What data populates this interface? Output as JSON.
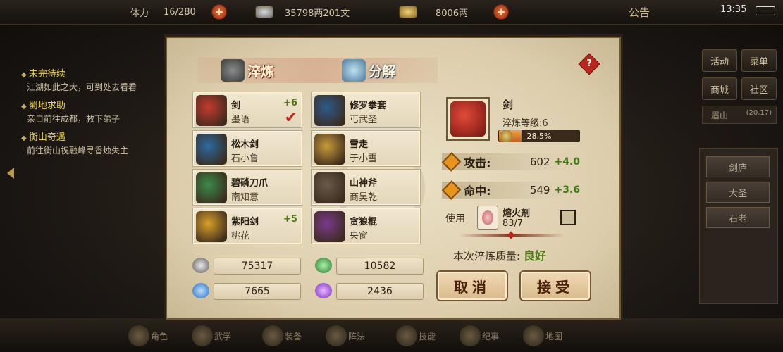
{
  "topbar": {
    "stamina_label": "体力",
    "stamina_value": "16/280",
    "silver_value": "35798两201文",
    "gold_value": "8006两",
    "notice_label": "公告",
    "time": "13:35"
  },
  "quests": [
    {
      "title": "未完待续",
      "desc": "江湖如此之大，可到处去看看"
    },
    {
      "title": "蜀地求助",
      "desc": "亲自前往成都，救下弟子"
    },
    {
      "title": "衡山奇遇",
      "desc": "前往衡山祝融峰寻香烛失主"
    }
  ],
  "right_menu": {
    "buttons": [
      "活动",
      "菜单",
      "商城",
      "社区"
    ],
    "location": "眉山",
    "location_coord": "(20,17)",
    "list": [
      "剑庐",
      "大圣",
      "石老"
    ]
  },
  "dialog": {
    "tab_refine": "淬炼",
    "tab_decompose": "分解",
    "help_icon": "?",
    "items": [
      {
        "name": "剑",
        "owner": "墨语",
        "level": "+6",
        "checked": true,
        "color": "#c43a2e"
      },
      {
        "name": "修罗拳套",
        "owner": "丐武圣",
        "level": "",
        "checked": false,
        "color": "#2e5a8a"
      },
      {
        "name": "松木剑",
        "owner": "石小鲁",
        "level": "",
        "checked": false,
        "color": "#2a6aa0"
      },
      {
        "name": "雪走",
        "owner": "于小雪",
        "level": "",
        "checked": false,
        "color": "#c89a3a"
      },
      {
        "name": "碧磷刀爪",
        "owner": "南知意",
        "level": "",
        "checked": false,
        "color": "#3a8a4a"
      },
      {
        "name": "山神斧",
        "owner": "商昊乾",
        "level": "",
        "checked": false,
        "color": "#6a5a4a"
      },
      {
        "name": "紫阳剑",
        "owner": "桃花",
        "level": "+5",
        "checked": false,
        "color": "#d8a02a"
      },
      {
        "name": "贪狼棍",
        "owner": "央窗",
        "level": "",
        "checked": false,
        "color": "#7a3a8a"
      }
    ],
    "check_mark": "✔",
    "resources": [
      {
        "value": "75317",
        "color": "#9a9a9a"
      },
      {
        "value": "10582",
        "color": "#3aa04a"
      },
      {
        "value": "7665",
        "color": "#3a8ad8"
      },
      {
        "value": "2436",
        "color": "#a04ad8"
      }
    ],
    "detail": {
      "name": "剑",
      "refine_level": "淬炼等级:6",
      "progress_text": "28.5%",
      "progress_fraction": 0.285,
      "stats": [
        {
          "label": "攻击:",
          "value": "602",
          "bonus": "+4.0"
        },
        {
          "label": "命中:",
          "value": "549",
          "bonus": "+3.6"
        }
      ],
      "use_label": "使用",
      "material_name": "熔火剂",
      "material_count": "83/7",
      "quality_label": "本次淬炼质量:",
      "quality_value": "良好"
    },
    "cancel_label": "取消",
    "accept_label": "接受"
  },
  "bottombar": {
    "items": [
      "角色",
      "武学",
      "装备",
      "阵法",
      "技能",
      "纪事",
      "地图"
    ]
  }
}
